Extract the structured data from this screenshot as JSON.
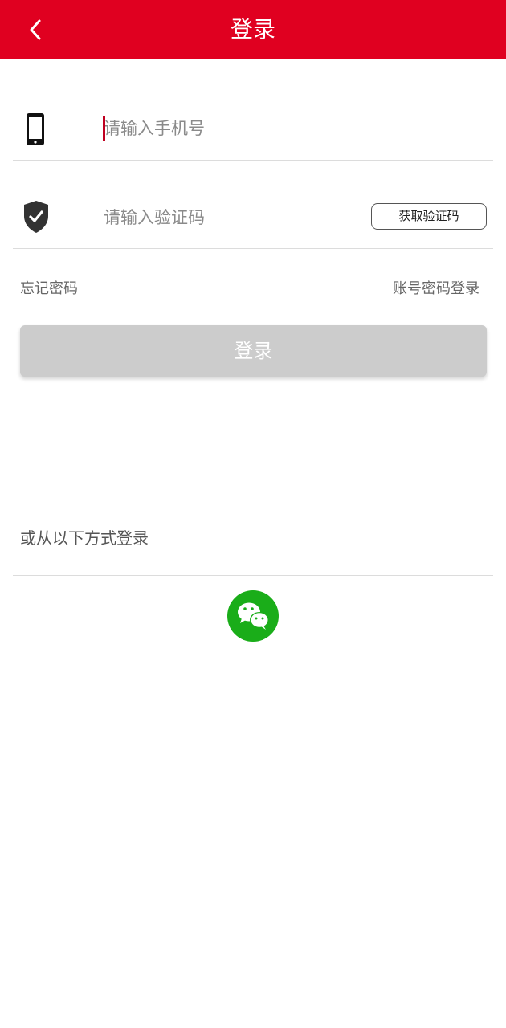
{
  "header": {
    "title": "登录",
    "background_color": "#e00020"
  },
  "phone_row": {
    "icon": "phone-icon",
    "placeholder": "请输入手机号",
    "value": ""
  },
  "code_row": {
    "icon": "shield-check-icon",
    "placeholder": "请输入验证码",
    "value": "",
    "get_code_label": "获取验证码"
  },
  "links": {
    "forgot_password": "忘记密码",
    "account_password_login": "账号密码登录"
  },
  "login_button": {
    "label": "登录",
    "state": "disabled",
    "color": "#cccccc"
  },
  "other_methods": {
    "label": "或从以下方式登录",
    "methods": [
      {
        "name": "wechat",
        "icon": "wechat-icon",
        "color": "#1aad19"
      }
    ]
  }
}
